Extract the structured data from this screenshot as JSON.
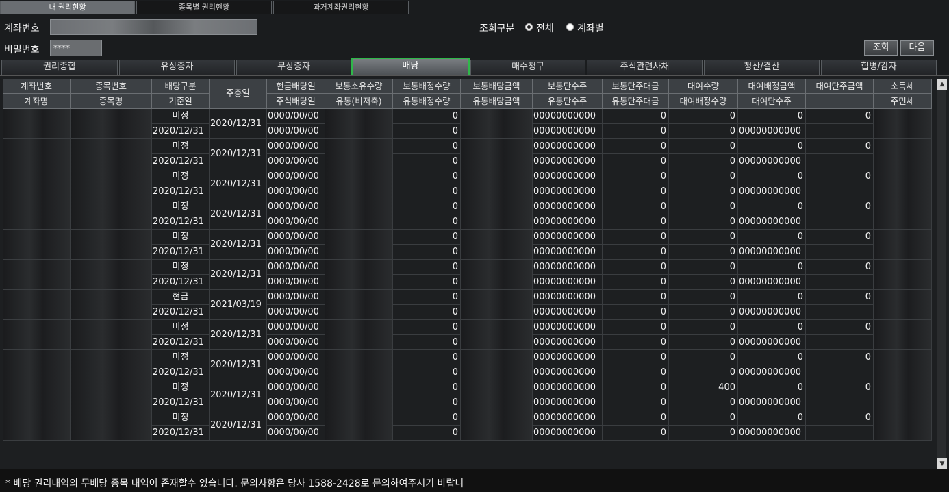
{
  "top_tabs": [
    "내 권리현황",
    "종목별 권리현황",
    "과거계좌권리현황"
  ],
  "account": {
    "label": "계좌번호",
    "password_label": "비밀번호",
    "password_value": "****"
  },
  "query": {
    "label": "조회구분",
    "options": [
      "전체",
      "계좌별"
    ],
    "selected": "전체"
  },
  "buttons": {
    "search": "조회",
    "next": "다음"
  },
  "category_tabs": [
    "권리종합",
    "유상증자",
    "무상증자",
    "배당",
    "매수청구",
    "주식관련사채",
    "청산/결산",
    "합병/감자"
  ],
  "active_category": "배당",
  "headers": {
    "row1": [
      "계좌번호",
      "종목번호",
      "배당구분",
      "주총일",
      "현금배당일",
      "보통소유수량",
      "보통배정수량",
      "보통배당금액",
      "보통단수주",
      "보통단주대금",
      "대여수량",
      "대여배정금액",
      "대여단주금액",
      "소득세"
    ],
    "row2": [
      "계좌명",
      "종목명",
      "기준일",
      "",
      "주식배당일",
      "유통(비저축)",
      "유통배정수량",
      "유통배당금액",
      "유통단수주",
      "유통단주대금",
      "대여배정수량",
      "대여단수주",
      "",
      "주민세"
    ]
  },
  "records": [
    {
      "type": "미정",
      "date": "2020/12/31",
      "meeting": "2020/12/31",
      "cash_date": "0000/00/00",
      "stock_date": "0000/00/00",
      "alloc": "0",
      "alloc2": "0",
      "frac": "00000000000",
      "frac2": "00000000000",
      "frac_amt": "0",
      "frac_amt2": "0",
      "lend": "0",
      "lend_alloc_qty": "0",
      "lend_alloc": "0",
      "lend_frac": "00000000000",
      "lend_frac_amt": "0"
    },
    {
      "type": "미정",
      "date": "2020/12/31",
      "meeting": "2020/12/31",
      "cash_date": "0000/00/00",
      "stock_date": "0000/00/00",
      "alloc": "0",
      "alloc2": "0",
      "frac": "00000000000",
      "frac2": "00000000000",
      "frac_amt": "0",
      "frac_amt2": "0",
      "lend": "0",
      "lend_alloc_qty": "0",
      "lend_alloc": "0",
      "lend_frac": "00000000000",
      "lend_frac_amt": "0"
    },
    {
      "type": "미정",
      "date": "2020/12/31",
      "meeting": "2020/12/31",
      "cash_date": "0000/00/00",
      "stock_date": "0000/00/00",
      "alloc": "0",
      "alloc2": "0",
      "frac": "00000000000",
      "frac2": "00000000000",
      "frac_amt": "0",
      "frac_amt2": "0",
      "lend": "0",
      "lend_alloc_qty": "0",
      "lend_alloc": "0",
      "lend_frac": "00000000000",
      "lend_frac_amt": "0"
    },
    {
      "type": "미정",
      "date": "2020/12/31",
      "meeting": "2020/12/31",
      "cash_date": "0000/00/00",
      "stock_date": "0000/00/00",
      "alloc": "0",
      "alloc2": "0",
      "frac": "00000000000",
      "frac2": "00000000000",
      "frac_amt": "0",
      "frac_amt2": "0",
      "lend": "0",
      "lend_alloc_qty": "0",
      "lend_alloc": "0",
      "lend_frac": "00000000000",
      "lend_frac_amt": "0"
    },
    {
      "type": "미정",
      "date": "2020/12/31",
      "meeting": "2020/12/31",
      "cash_date": "0000/00/00",
      "stock_date": "0000/00/00",
      "alloc": "0",
      "alloc2": "0",
      "frac": "00000000000",
      "frac2": "00000000000",
      "frac_amt": "0",
      "frac_amt2": "0",
      "lend": "0",
      "lend_alloc_qty": "0",
      "lend_alloc": "0",
      "lend_frac": "00000000000",
      "lend_frac_amt": "0"
    },
    {
      "type": "미정",
      "date": "2020/12/31",
      "meeting": "2020/12/31",
      "cash_date": "0000/00/00",
      "stock_date": "0000/00/00",
      "alloc": "0",
      "alloc2": "0",
      "frac": "00000000000",
      "frac2": "00000000000",
      "frac_amt": "0",
      "frac_amt2": "0",
      "lend": "0",
      "lend_alloc_qty": "0",
      "lend_alloc": "0",
      "lend_frac": "00000000000",
      "lend_frac_amt": "0"
    },
    {
      "type": "현금",
      "date": "2020/12/31",
      "meeting": "2021/03/19",
      "cash_date": "0000/00/00",
      "stock_date": "0000/00/00",
      "alloc": "0",
      "alloc2": "0",
      "frac": "00000000000",
      "frac2": "00000000000",
      "frac_amt": "0",
      "frac_amt2": "0",
      "lend": "0",
      "lend_alloc_qty": "0",
      "lend_alloc": "0",
      "lend_frac": "00000000000",
      "lend_frac_amt": "0"
    },
    {
      "type": "미정",
      "date": "2020/12/31",
      "meeting": "2020/12/31",
      "cash_date": "0000/00/00",
      "stock_date": "0000/00/00",
      "alloc": "0",
      "alloc2": "0",
      "frac": "00000000000",
      "frac2": "00000000000",
      "frac_amt": "0",
      "frac_amt2": "0",
      "lend": "0",
      "lend_alloc_qty": "0",
      "lend_alloc": "0",
      "lend_frac": "00000000000",
      "lend_frac_amt": "0"
    },
    {
      "type": "미정",
      "date": "2020/12/31",
      "meeting": "2020/12/31",
      "cash_date": "0000/00/00",
      "stock_date": "0000/00/00",
      "alloc": "0",
      "alloc2": "0",
      "frac": "00000000000",
      "frac2": "00000000000",
      "frac_amt": "0",
      "frac_amt2": "0",
      "lend": "0",
      "lend_alloc_qty": "0",
      "lend_alloc": "0",
      "lend_frac": "00000000000",
      "lend_frac_amt": "0"
    },
    {
      "type": "미정",
      "date": "2020/12/31",
      "meeting": "2020/12/31",
      "cash_date": "0000/00/00",
      "stock_date": "0000/00/00",
      "alloc": "0",
      "alloc2": "0",
      "frac": "00000000000",
      "frac2": "00000000000",
      "frac_amt": "0",
      "frac_amt2": "0",
      "lend": "400",
      "lend_alloc_qty": "0",
      "lend_alloc": "0",
      "lend_frac": "00000000000",
      "lend_frac_amt": "0"
    },
    {
      "type": "미정",
      "date": "2020/12/31",
      "meeting": "2020/12/31",
      "cash_date": "0000/00/00",
      "stock_date": "0000/00/00",
      "alloc": "0",
      "alloc2": "0",
      "frac": "00000000000",
      "frac2": "00000000000",
      "frac_amt": "0",
      "frac_amt2": "0",
      "lend": "0",
      "lend_alloc_qty": "0",
      "lend_alloc": "0",
      "lend_frac": "00000000000",
      "lend_frac_amt": "0"
    }
  ],
  "footer_note": "* 배당 권리내역의 무배당 종목 내역이 존재할수 있습니다. 문의사항은 당사 1588-2428로 문의하여주시기 바랍니"
}
